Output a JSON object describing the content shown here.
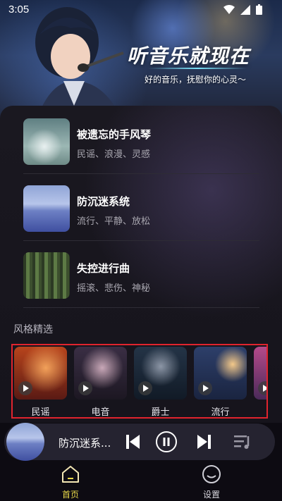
{
  "status_bar": {
    "time": "3:05"
  },
  "hero": {
    "title": "听音乐就现在",
    "subtitle": "好的音乐，抚慰你的心灵～"
  },
  "songs": [
    {
      "name": "被遗忘的手风琴",
      "tags": "民谣、浪漫、灵感"
    },
    {
      "name": "防沉迷系统",
      "tags": "流行、平静、放松"
    },
    {
      "name": "失控进行曲",
      "tags": "摇滚、悲伤、神秘"
    }
  ],
  "style_section": {
    "title": "风格精选",
    "genres": [
      {
        "label": "民谣"
      },
      {
        "label": "电音"
      },
      {
        "label": "爵士"
      },
      {
        "label": "流行"
      }
    ]
  },
  "player": {
    "title": "防沉迷系..."
  },
  "tabs": [
    {
      "label": "首页",
      "active": true
    },
    {
      "label": "设置",
      "active": false
    }
  ],
  "colors": {
    "accent_active": "#e8d84a",
    "highlight_border": "#e0242e"
  }
}
